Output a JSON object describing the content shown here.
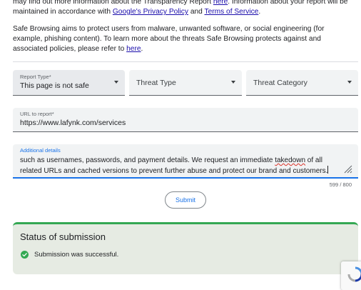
{
  "intro": {
    "p1_text_a": "may find out more information about the Transparency Report ",
    "p1_link_here": "here",
    "p1_text_b": ". Information about your report will be maintained in accordance with ",
    "p1_link_privacy": "Google's Privacy Policy",
    "p1_text_c": " and ",
    "p1_link_terms": "Terms of Service",
    "p1_text_d": ".",
    "p2_text_a": "Safe Browsing aims to protect users from malware, unwanted software, or social engineering (for example, phishing content). To learn more about the threats Safe Browsing protects against and associated policies, please refer to ",
    "p2_link_here": "here",
    "p2_text_b": "."
  },
  "form": {
    "report_type": {
      "label": "Report Type*",
      "value": "This page is not safe"
    },
    "threat_type": {
      "placeholder": "Threat Type"
    },
    "threat_category": {
      "placeholder": "Threat Category"
    },
    "url": {
      "label": "URL to report*",
      "value": "https://www.lafynk.com/services"
    },
    "details": {
      "label": "Additional details",
      "text_a": "such as usernames, passwords, and payment details. We request an immediate ",
      "misspelled": "takedown",
      "text_b": " of all related URLs and cached versions to prevent further abuse and protect our brand and customers.",
      "counter": "599 / 800"
    },
    "submit_label": "Submit"
  },
  "status": {
    "title": "Status of submission",
    "message": "Submission was successful."
  },
  "icons": {
    "dropdown": "chevron-down-icon",
    "success": "check-circle-icon",
    "resize": "resize-handle-icon",
    "captcha": "recaptcha-icon"
  },
  "colors": {
    "link": "#1a0dab",
    "accent": "#1a73e8",
    "success": "#34a853",
    "status_bg": "#e6ebe3"
  }
}
